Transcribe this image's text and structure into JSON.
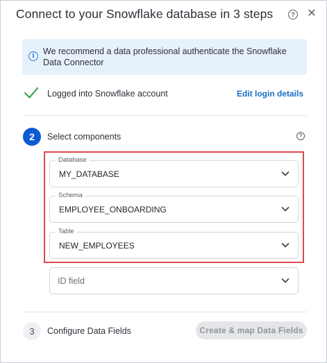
{
  "dialog": {
    "title": "Connect to your Snowflake database in 3 steps",
    "help_icon": "question-circle-icon",
    "close_icon": "close-icon",
    "close_glyph": "✕",
    "help_glyph": "?"
  },
  "info": {
    "icon": "info-icon",
    "glyph": "i",
    "text": "We recommend a data professional authenticate the Snowflake Data Connector"
  },
  "step1": {
    "label": "Logged into Snowflake account",
    "link": "Edit login details",
    "status_icon": "checkmark-icon"
  },
  "step2": {
    "number": "2",
    "label": "Select components",
    "help_glyph": "?",
    "fields": {
      "database": {
        "label": "Database",
        "value": "MY_DATABASE"
      },
      "schema": {
        "label": "Schema",
        "value": "EMPLOYEE_ONBOARDING"
      },
      "table": {
        "label": "Table",
        "value": "NEW_EMPLOYEES"
      },
      "id_field": {
        "placeholder": "ID field"
      }
    }
  },
  "step3": {
    "number": "3",
    "label": "Configure Data Fields",
    "button": "Create & map Data Fields"
  },
  "colors": {
    "accent": "#0b5bd3",
    "link": "#1a6fc4",
    "success": "#3aa757",
    "highlight": "#d94a4f",
    "info_bg": "#e7f1fb"
  }
}
